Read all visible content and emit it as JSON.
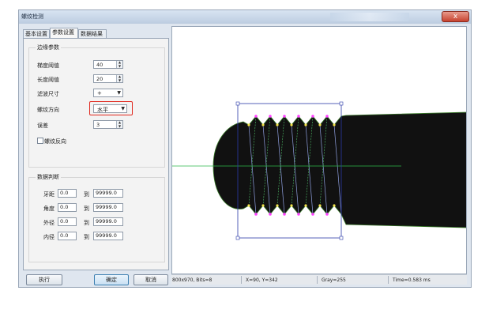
{
  "window": {
    "title": "螺纹检测",
    "close": "x"
  },
  "tabs": [
    {
      "label": "基本设置"
    },
    {
      "label": "参数设置"
    },
    {
      "label": "数据结果"
    }
  ],
  "contour": {
    "title": "边缘参数",
    "fields": [
      {
        "label": "梯度阈值",
        "value": "40"
      },
      {
        "label": "长度阈值",
        "value": "20"
      }
    ],
    "filter_size": {
      "label": "滤波尺寸",
      "value": "+"
    },
    "thread_direction": {
      "label": "螺纹方向",
      "value": "水平"
    },
    "error": {
      "label": "误差",
      "value": "3"
    },
    "reverse_checkbox": {
      "label": "螺纹反向",
      "checked": false
    }
  },
  "judge": {
    "title": "数据判断",
    "rows": [
      {
        "label": "牙距",
        "min": "0.0",
        "to": "到",
        "max": "99999.0"
      },
      {
        "label": "角度",
        "min": "0.0",
        "to": "到",
        "max": "99999.0"
      },
      {
        "label": "外径",
        "min": "0.0",
        "to": "到",
        "max": "99999.0"
      },
      {
        "label": "内径",
        "min": "0.0",
        "to": "到",
        "max": "99999.0"
      }
    ]
  },
  "buttons": {
    "execute": "执行",
    "ok": "确定",
    "cancel": "取消"
  },
  "status": {
    "image_info": "800x970, Bits=8",
    "position": "X=90, Y=342",
    "gray": "Gray=255",
    "time": "Time=0.583 ms"
  },
  "colors": {
    "highlight": "#e0281e",
    "roi": "#2b3aa8",
    "guide_line": "#2db84a"
  }
}
